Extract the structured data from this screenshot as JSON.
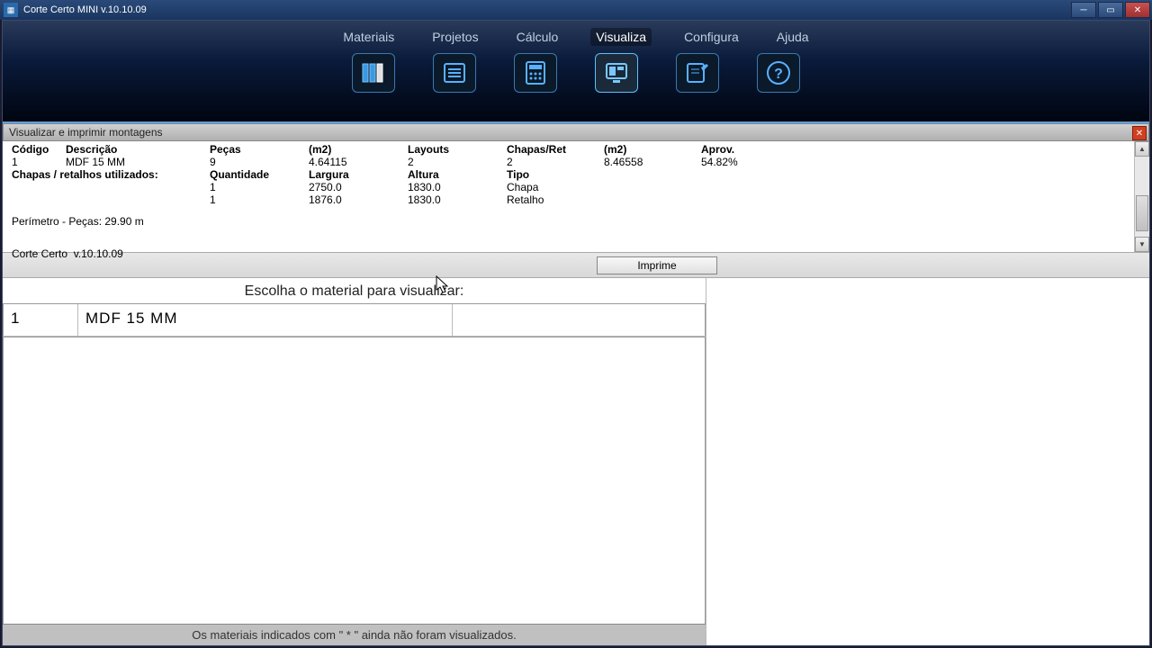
{
  "window": {
    "title": "Corte Certo  MINI  v.10.10.09"
  },
  "menu": {
    "items": [
      "Materiais",
      "Projetos",
      "Cálculo",
      "Visualiza",
      "Configura",
      "Ajuda"
    ],
    "activeIndex": 3
  },
  "panel": {
    "title": "Visualizar e imprimir montagens"
  },
  "info": {
    "headers1": {
      "codigo": "Código",
      "descricao": "Descrição",
      "pecas": "Peças",
      "m2a": "(m2)",
      "layouts": "Layouts",
      "chapasret": "Chapas/Ret",
      "m2b": "(m2)",
      "aprov": "Aprov."
    },
    "row1": {
      "codigo": "1",
      "descricao": "MDF 15 MM",
      "pecas": "9",
      "m2a": "4.64115",
      "layouts": "2",
      "chapasret": "2",
      "m2b": "8.46558",
      "aprov": "54.82%"
    },
    "headers2": {
      "label": "Chapas / retalhos utilizados:",
      "quantidade": "Quantidade",
      "largura": "Largura",
      "altura": "Altura",
      "tipo": "Tipo"
    },
    "row2a": {
      "quantidade": "1",
      "largura": "2750.0",
      "altura": "1830.0",
      "tipo": "Chapa"
    },
    "row2b": {
      "quantidade": "1",
      "largura": "1876.0",
      "altura": "1830.0",
      "tipo": "Retalho"
    },
    "perimetro": "Perímetro - Peças: 29.90 m",
    "version": "Corte Certo  v.10.10.09"
  },
  "buttons": {
    "print": "Imprime"
  },
  "materials": {
    "header": "Escolha o material para visualizar:",
    "items": [
      {
        "id": "1",
        "name": "MDF 15 MM"
      }
    ],
    "footer": "Os materiais indicados com \" * \" ainda não foram visualizados."
  }
}
